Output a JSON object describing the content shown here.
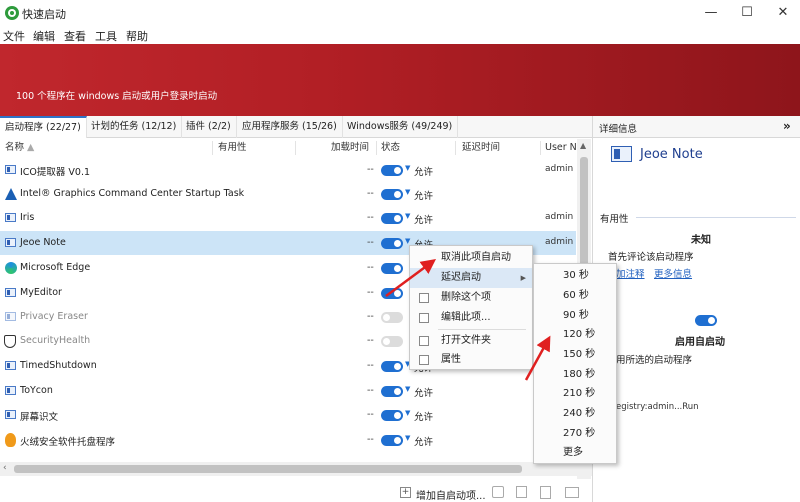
{
  "window": {
    "title": "快速启动",
    "controls": {
      "minimize": "—",
      "maximize": "☐",
      "close": "✕"
    }
  },
  "menu": [
    "文件",
    "编辑",
    "查看",
    "工具",
    "帮助"
  ],
  "banner": {
    "text": "100 个程序在 windows 启动或用户登录时启动"
  },
  "tabs": [
    "启动程序 (22/27)",
    "计划的任务 (12/12)",
    "插件 (2/2)",
    "应用程序服务 (15/26)",
    "Windows服务 (49/249)"
  ],
  "columns": [
    "名称",
    "有用性",
    "加载时间",
    "状态",
    "延迟时间",
    "User Na"
  ],
  "rows": [
    {
      "name": "ICO提取器 V0.1",
      "dash": "--",
      "status": "允许",
      "user": "admin",
      "on": true
    },
    {
      "name": "Intel® Graphics Command Center Startup Task",
      "dash": "--",
      "status": "允许",
      "user": "",
      "on": true
    },
    {
      "name": "Iris",
      "dash": "--",
      "status": "允许",
      "user": "admin",
      "on": true
    },
    {
      "name": "Jeoe Note",
      "dash": "--",
      "status": "允许",
      "user": "admin",
      "on": true
    },
    {
      "name": "Microsoft Edge",
      "dash": "--",
      "status": "",
      "user": "",
      "on": true
    },
    {
      "name": "MyEditor",
      "dash": "--",
      "status": "",
      "user": "",
      "on": true
    },
    {
      "name": "Privacy Eraser",
      "dash": "--",
      "status": "",
      "user": "",
      "on": false
    },
    {
      "name": "SecurityHealth",
      "dash": "--",
      "status": "",
      "user": "",
      "on": false
    },
    {
      "name": "TimedShutdown",
      "dash": "--",
      "status": "允许",
      "user": "",
      "on": true
    },
    {
      "name": "ToYcon",
      "dash": "--",
      "status": "允许",
      "user": "",
      "on": true
    },
    {
      "name": "屏幕识文",
      "dash": "--",
      "status": "允许",
      "user": "",
      "on": true
    },
    {
      "name": "火绒安全软件托盘程序",
      "dash": "--",
      "status": "允许",
      "user": "",
      "on": true
    }
  ],
  "right_panel": {
    "header": "详细信息",
    "expand": "»",
    "app_name": "Jeoe Note",
    "usefulness_heading": "有用性",
    "usefulness_value": "未知",
    "first_comment": "首先评论该启动程序",
    "add_comment": "加注释",
    "more_info": "更多信息",
    "enable_label": "启用自启动",
    "enable_desc": "用所选的启动程序",
    "registry": "egistry:admin...Run"
  },
  "context_menu": [
    {
      "label": "取消此项自启动",
      "icon": ""
    },
    {
      "label": "延迟启动",
      "icon": "",
      "submenu": true
    },
    {
      "label": "删除这个项",
      "icon": "trash-icon"
    },
    {
      "label": "编辑此项...",
      "icon": "edit-icon"
    },
    {
      "label": "打开文件夹",
      "icon": "folder-search-icon"
    },
    {
      "label": "属性",
      "icon": "properties-icon"
    }
  ],
  "submenu": [
    "30 秒",
    "60 秒",
    "90 秒",
    "120 秒",
    "150 秒",
    "180 秒",
    "210 秒",
    "240 秒",
    "270 秒",
    "更多"
  ],
  "bottom": {
    "add_label": "增加自启动项..."
  },
  "colors": {
    "banner": "#b21f25",
    "accent": "#1f6fd1",
    "arrow": "#e02020",
    "selected_row": "#cce4f7"
  }
}
